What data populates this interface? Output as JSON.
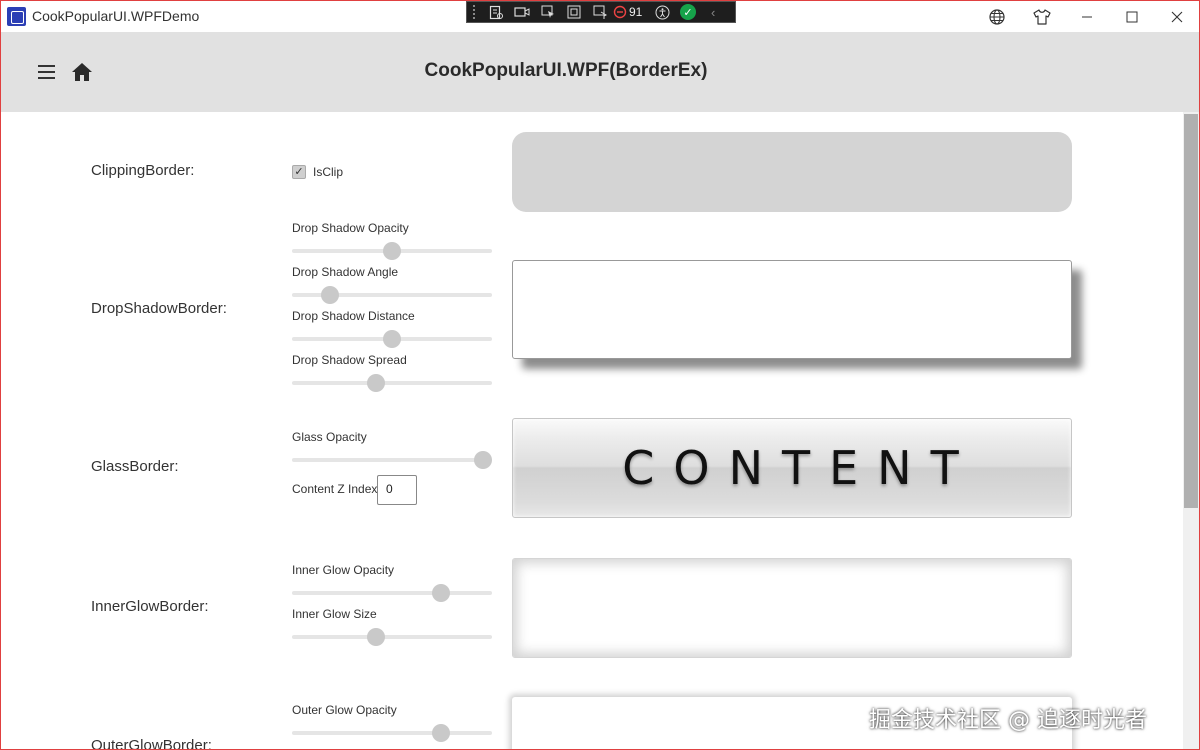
{
  "window": {
    "title": "CookPopularUI.WPFDemo",
    "accent_border": "#e04040"
  },
  "debug_toolbar": {
    "icons": [
      "live-visual-tree-icon",
      "record-icon",
      "select-element-icon",
      "layout-adorner-icon",
      "track-focus-icon",
      "binding-failures-icon",
      "accessibility-icon",
      "hot-reload-ok-icon",
      "collapse-icon"
    ],
    "binding_count": "91"
  },
  "title_bar_buttons": {
    "icons": [
      "globe-icon",
      "theme-shirt-icon",
      "minimize-icon",
      "maximize-icon",
      "close-icon"
    ]
  },
  "header": {
    "title": "CookPopularUI.WPF(BorderEx)",
    "background": "#e1e1e1"
  },
  "rows": {
    "clipping": {
      "label": "ClippingBorder:",
      "checkbox_label": "IsClip",
      "checked": true
    },
    "drop_shadow": {
      "label": "DropShadowBorder:",
      "sliders": [
        {
          "label": "Drop Shadow Opacity",
          "value": 0.5
        },
        {
          "label": "Drop Shadow Angle",
          "value": 0.16
        },
        {
          "label": "Drop Shadow Distance",
          "value": 0.5
        },
        {
          "label": "Drop Shadow Spread",
          "value": 0.41
        }
      ]
    },
    "glass": {
      "label": "GlassBorder:",
      "opacity_label": "Glass Opacity",
      "opacity_value": 1.0,
      "z_index_label": "Content Z Index",
      "z_index_value": "0",
      "content_text": "CONTENT"
    },
    "inner_glow": {
      "label": "InnerGlowBorder:",
      "sliders": [
        {
          "label": "Inner Glow Opacity",
          "value": 0.77
        },
        {
          "label": "Inner Glow Size",
          "value": 0.41
        }
      ]
    },
    "outer_glow": {
      "label": "OuterGlowBorder:",
      "sliders": [
        {
          "label": "Outer Glow Opacity",
          "value": 0.77
        }
      ]
    }
  },
  "watermark": "掘金技术社区 @ 追逐时光者"
}
